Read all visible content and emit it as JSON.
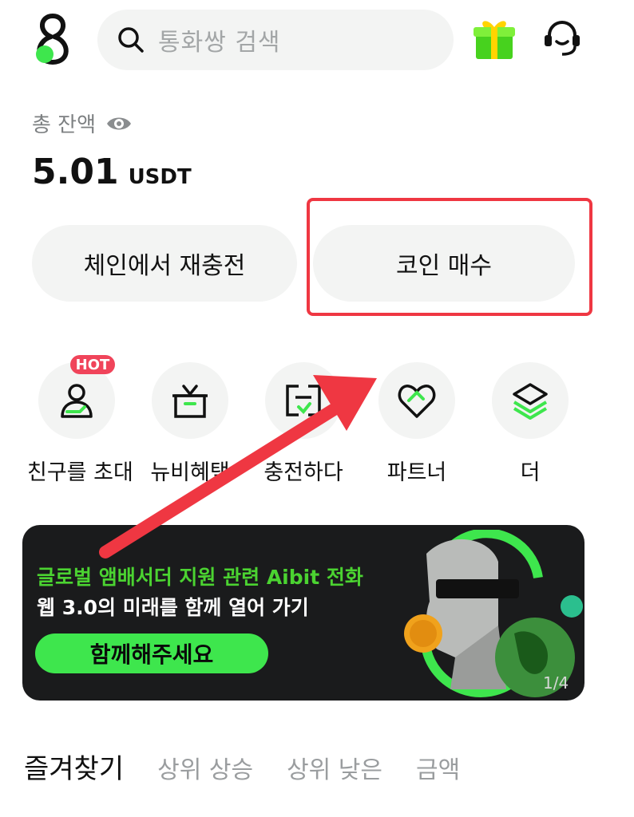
{
  "header": {
    "search_placeholder": "통화쌍 검색",
    "icons": [
      "app-logo-icon",
      "search-icon",
      "gift-icon",
      "headset-support-icon"
    ]
  },
  "balance": {
    "label": "총 잔액",
    "amount": "5.01",
    "currency": "USDT"
  },
  "actions": {
    "recharge_label": "체인에서 재충전",
    "buy_label": "코인 매수"
  },
  "quick_menu": [
    {
      "label": "친구를 초대",
      "badge": "HOT",
      "icon": "invite-friend-icon"
    },
    {
      "label": "뉴비혜택",
      "icon": "gift-box-icon"
    },
    {
      "label": "충전하다",
      "icon": "deposit-card-icon"
    },
    {
      "label": "파트너",
      "icon": "partner-heart-icon"
    },
    {
      "label": "더",
      "icon": "more-layers-icon"
    }
  ],
  "banner": {
    "line1": "글로벌 앰배서더 지원 관련 Aibit 전화",
    "line2": "웹 3.0의 미래를 함께 열어 가기",
    "cta": "함께해주세요",
    "pager": "1/4"
  },
  "tabs": [
    "즐겨찾기",
    "상위 상승",
    "상위 낮은",
    "금액"
  ],
  "colors": {
    "accent_green": "#3ee64d",
    "highlight_red": "#ef3742",
    "hot_badge": "#f0445a",
    "button_bg": "#f3f4f3"
  }
}
